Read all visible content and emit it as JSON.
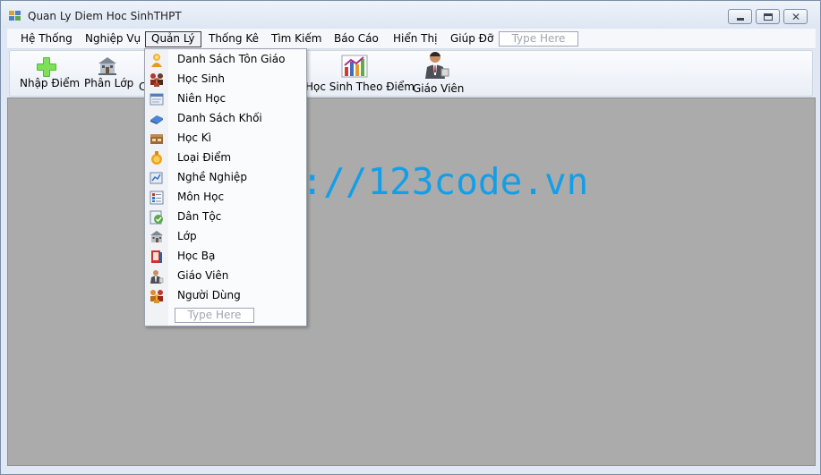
{
  "window": {
    "title": "Quan Ly Diem Hoc SinhTHPT",
    "minimize_glyph": "",
    "close_glyph": "✕"
  },
  "menu": {
    "items": [
      "Hệ Thống",
      "Nghiệp Vụ",
      "Quản Lý",
      "Thống Kê",
      "Tìm Kiếm",
      "Báo Cáo",
      "Hiển Thị",
      "Giúp Đỡ"
    ],
    "active": "Quản Lý",
    "type_here": "Type Here"
  },
  "toolbar": {
    "nhap_diem": "Nhập Điểm",
    "phan_lop": "Phân Lớp",
    "partial_c": "C",
    "hoc_sinh_theo_diem": "Học Sinh Theo Điểm",
    "giao_vien": "Giáo Viên"
  },
  "dropdown": {
    "items": [
      {
        "label": "Danh Sách Tôn Giáo",
        "icon": "religion-icon"
      },
      {
        "label": "Học Sinh",
        "icon": "students-icon"
      },
      {
        "label": "Niên Học",
        "icon": "school-year-icon"
      },
      {
        "label": "Danh Sách Khối",
        "icon": "grade-block-icon"
      },
      {
        "label": "Học Kì",
        "icon": "semester-icon"
      },
      {
        "label": "Loại Điểm",
        "icon": "score-type-icon"
      },
      {
        "label": "Nghề Nghiệp",
        "icon": "occupation-icon"
      },
      {
        "label": "Môn Học",
        "icon": "subject-icon"
      },
      {
        "label": "Dân Tộc",
        "icon": "ethnicity-icon"
      },
      {
        "label": "Lớp",
        "icon": "class-icon"
      },
      {
        "label": "Học Bạ",
        "icon": "transcript-icon"
      },
      {
        "label": "Giáo Viên",
        "icon": "teacher-icon"
      },
      {
        "label": "Người Dùng",
        "icon": "users-icon"
      }
    ],
    "type_here": "Type Here"
  },
  "watermark": "https://123code.vn",
  "colors": {
    "watermark": "#139fe8",
    "mdi_background": "#ababab"
  }
}
